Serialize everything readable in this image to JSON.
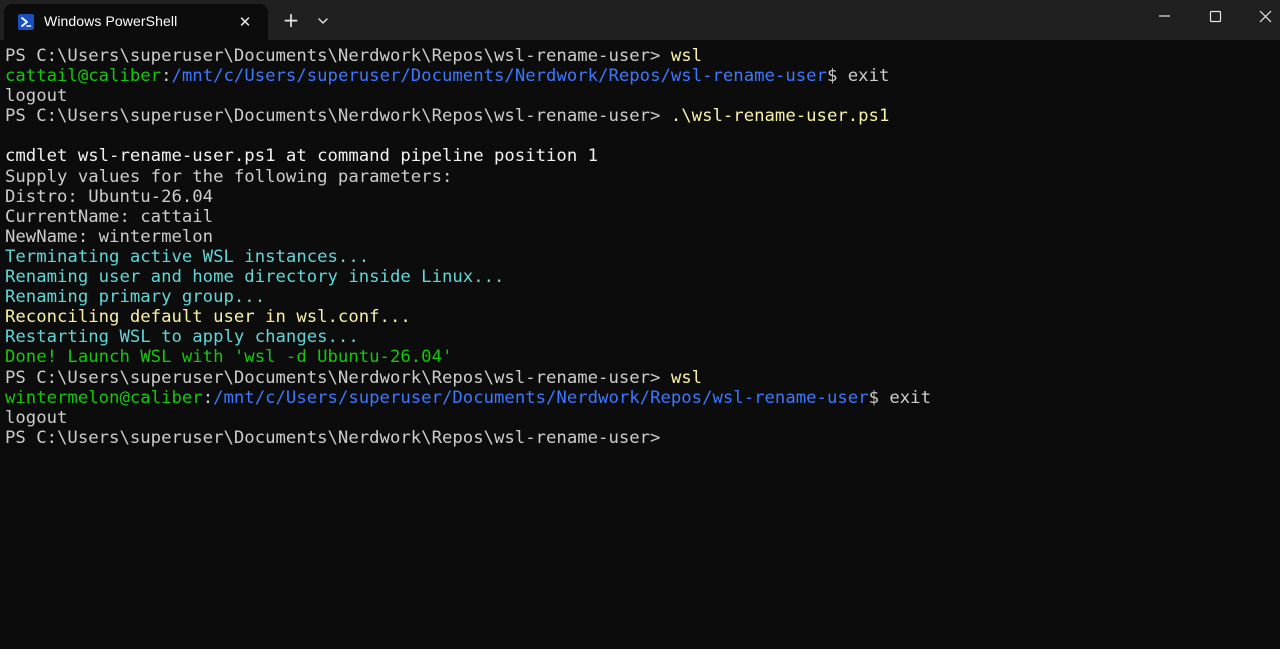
{
  "window": {
    "tab_title": "Windows PowerShell",
    "tab_icon": "powershell-icon",
    "close_tab_glyph": "✕",
    "new_tab_glyph": "+",
    "dropdown_icon": "chevron-down-icon",
    "minimize_icon": "minimize-icon",
    "maximize_icon": "maximize-icon",
    "close_icon": "close-icon"
  },
  "colors": {
    "background": "#0c0c0c",
    "titlebar": "#202020",
    "text": "#cccccc",
    "command": "#f9f1a5",
    "cyan": "#61d6d6",
    "green": "#16c60c",
    "blue": "#3b78ff"
  },
  "terminal": {
    "lines": [
      {
        "parts": [
          {
            "text": "PS C:\\Users\\superuser\\Documents\\Nerdwork\\Repos\\wsl-rename-user> ",
            "style": "w"
          },
          {
            "text": "wsl",
            "style": "y"
          }
        ]
      },
      {
        "parts": [
          {
            "text": "cattail@caliber",
            "style": "g"
          },
          {
            "text": ":",
            "style": "w"
          },
          {
            "text": "/mnt/c/Users/superuser/Documents/Nerdwork/Repos/wsl-rename-user",
            "style": "blue"
          },
          {
            "text": "$ exit",
            "style": "w"
          }
        ]
      },
      {
        "parts": [
          {
            "text": "logout",
            "style": "w"
          }
        ]
      },
      {
        "parts": [
          {
            "text": "PS C:\\Users\\superuser\\Documents\\Nerdwork\\Repos\\wsl-rename-user> ",
            "style": "w"
          },
          {
            "text": ".\\wsl-rename-user.ps1",
            "style": "y"
          }
        ]
      },
      {
        "parts": [
          {
            "text": "",
            "style": "w"
          }
        ]
      },
      {
        "parts": [
          {
            "text": "cmdlet wsl-rename-user.ps1 at command pipeline position 1",
            "style": "b"
          }
        ]
      },
      {
        "parts": [
          {
            "text": "Supply values for the following parameters:",
            "style": "w"
          }
        ]
      },
      {
        "parts": [
          {
            "text": "Distro: Ubuntu-26.04",
            "style": "w"
          }
        ]
      },
      {
        "parts": [
          {
            "text": "CurrentName: cattail",
            "style": "w"
          }
        ]
      },
      {
        "parts": [
          {
            "text": "NewName: wintermelon",
            "style": "w"
          }
        ]
      },
      {
        "parts": [
          {
            "text": "Terminating active WSL instances...",
            "style": "c"
          }
        ]
      },
      {
        "parts": [
          {
            "text": "Renaming user and home directory inside Linux...",
            "style": "c"
          }
        ]
      },
      {
        "parts": [
          {
            "text": "Renaming primary group...",
            "style": "c"
          }
        ]
      },
      {
        "parts": [
          {
            "text": "Reconciling default user in wsl.conf...",
            "style": "y"
          }
        ]
      },
      {
        "parts": [
          {
            "text": "Restarting WSL to apply changes...",
            "style": "c"
          }
        ]
      },
      {
        "parts": [
          {
            "text": "Done! Launch WSL with 'wsl -d Ubuntu-26.04'",
            "style": "g"
          }
        ]
      },
      {
        "parts": [
          {
            "text": "PS C:\\Users\\superuser\\Documents\\Nerdwork\\Repos\\wsl-rename-user> ",
            "style": "w"
          },
          {
            "text": "wsl",
            "style": "y"
          }
        ]
      },
      {
        "parts": [
          {
            "text": "wintermelon@caliber",
            "style": "g"
          },
          {
            "text": ":",
            "style": "w"
          },
          {
            "text": "/mnt/c/Users/superuser/Documents/Nerdwork/Repos/wsl-rename-user",
            "style": "blue"
          },
          {
            "text": "$ exit",
            "style": "w"
          }
        ]
      },
      {
        "parts": [
          {
            "text": "logout",
            "style": "w"
          }
        ]
      },
      {
        "parts": [
          {
            "text": "PS C:\\Users\\superuser\\Documents\\Nerdwork\\Repos\\wsl-rename-user>",
            "style": "w"
          }
        ]
      }
    ]
  }
}
